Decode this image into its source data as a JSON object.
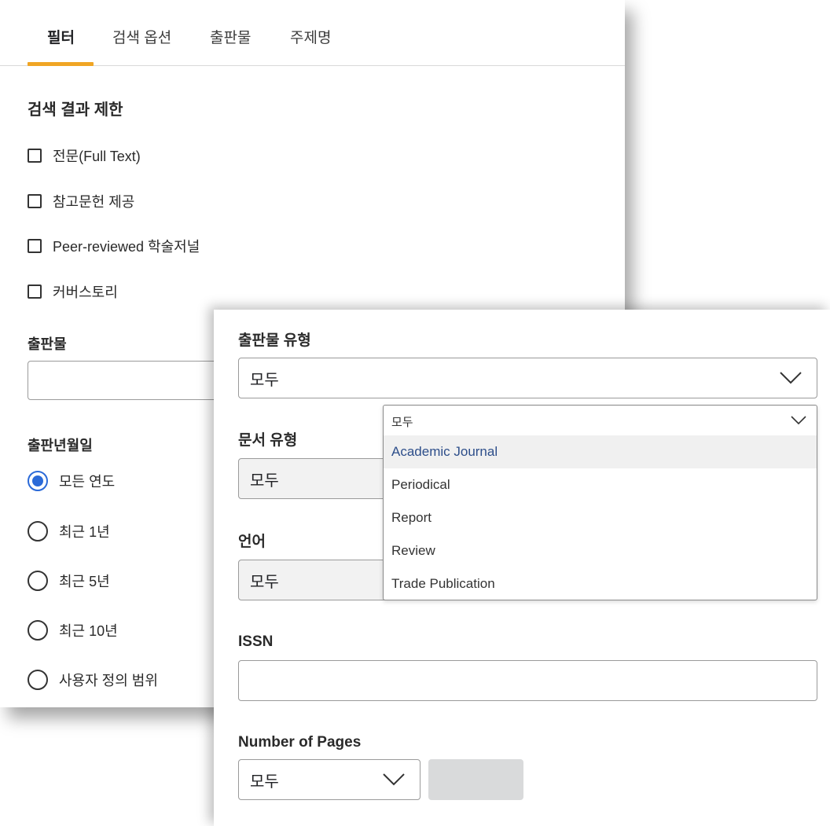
{
  "tabs": [
    "필터",
    "검색 옵션",
    "출판물",
    "주제명"
  ],
  "limit": {
    "title": "검색 결과 제한",
    "checkboxes": [
      "전문(Full Text)",
      "참고문헌 제공",
      "Peer-reviewed 학술저널",
      "커버스토리"
    ]
  },
  "publication": {
    "label": "출판물",
    "value": ""
  },
  "pub_date": {
    "label": "출판년월일",
    "options": [
      "모든 연도",
      "최근 1년",
      "최근 5년",
      "최근 10년",
      "사용자 정의 범위"
    ],
    "selected": "모든 연도"
  },
  "pub_type": {
    "label": "출판물 유형",
    "value": "모두"
  },
  "doc_type": {
    "label": "문서 유형",
    "value": "모두"
  },
  "language": {
    "label": "언어",
    "value": "모두"
  },
  "dropdown": {
    "value": "모두",
    "options": [
      "Academic Journal",
      "Periodical",
      "Report",
      "Review",
      "Trade Publication"
    ],
    "highlighted": "Academic Journal"
  },
  "issn": {
    "label": "ISSN",
    "value": ""
  },
  "pages": {
    "label": "Number of Pages",
    "value": "모두"
  },
  "colors": {
    "accent": "#f0a524",
    "radio_selected": "#2b6ad8",
    "highlight_text": "#2d4e8a"
  }
}
